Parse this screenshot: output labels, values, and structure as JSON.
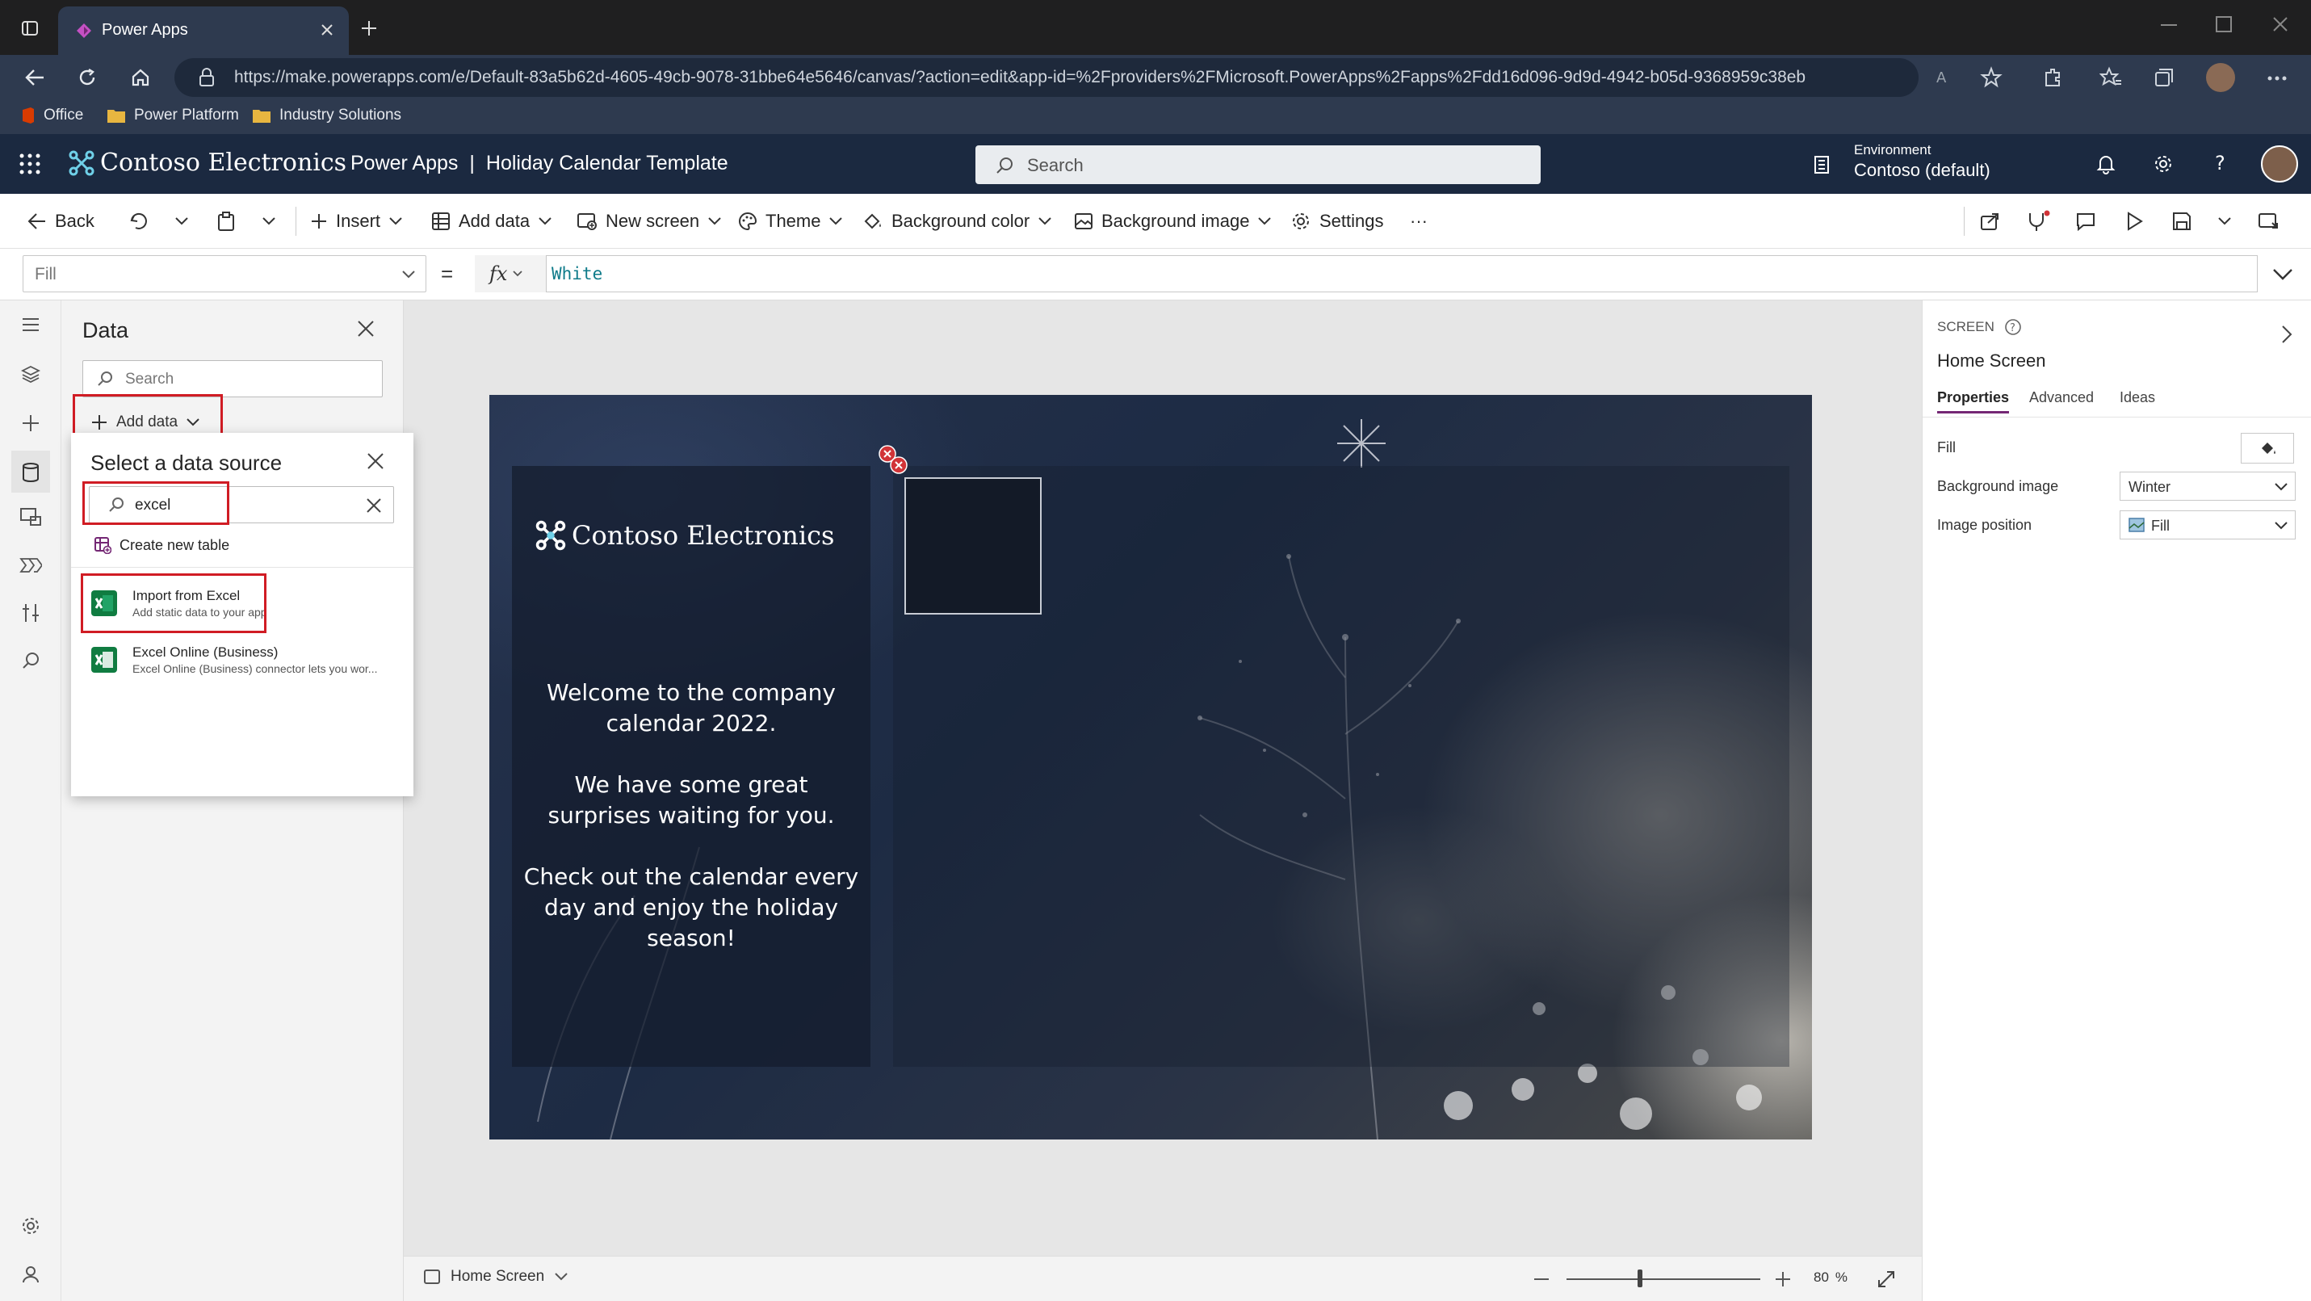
{
  "browser": {
    "tab_title": "Power Apps",
    "url": "https://make.powerapps.com/e/Default-83a5b62d-4605-49cb-9078-31bbe64e5646/canvas/?action=edit&app-id=%2Fproviders%2FMicrosoft.PowerApps%2Fapps%2Fdd16d096-9d9d-4942-b05d-9368959c38eb",
    "favorites": [
      "Office",
      "Power Platform",
      "Industry Solutions"
    ]
  },
  "header": {
    "brand": "Contoso Electronics",
    "app_name": "Power Apps",
    "separator": "|",
    "app_title": "Holiday Calendar Template",
    "search_placeholder": "Search",
    "environment_label": "Environment",
    "environment_value": "Contoso (default)"
  },
  "commandbar": {
    "back": "Back",
    "insert": "Insert",
    "add_data": "Add data",
    "new_screen": "New screen",
    "theme": "Theme",
    "background_color": "Background color",
    "background_image": "Background image",
    "settings": "Settings",
    "more": "···"
  },
  "formula": {
    "property": "Fill",
    "equals": "=",
    "fx": "fx",
    "value": "White"
  },
  "data_pane": {
    "title": "Data",
    "search_placeholder": "Search",
    "add_data": "Add data"
  },
  "popup": {
    "title": "Select a data source",
    "search_value": "excel",
    "create_new_table": "Create new table",
    "items": [
      {
        "title": "Import from Excel",
        "subtitle": "Add static data to your app"
      },
      {
        "title": "Excel Online (Business)",
        "subtitle": "Excel Online (Business) connector lets you wor..."
      }
    ]
  },
  "canvas": {
    "brand": "Contoso Electronics",
    "welcome_1a": "Welcome to the company",
    "welcome_1b": "calendar 2022.",
    "welcome_2a": "We have some great",
    "welcome_2b": "surprises waiting for you.",
    "welcome_3a": "Check out the calendar every",
    "welcome_3b": "day and enjoy the holiday",
    "welcome_3c": "season!"
  },
  "bottombar": {
    "screen_name": "Home Screen",
    "zoom_value": "80",
    "zoom_unit": "%",
    "zoom_level": 0.8
  },
  "properties": {
    "kind": "SCREEN",
    "name": "Home Screen",
    "tabs": [
      "Properties",
      "Advanced",
      "Ideas"
    ],
    "fill_label": "Fill",
    "bg_image_label": "Background image",
    "bg_image_value": "Winter",
    "image_position_label": "Image position",
    "image_position_value": "Fill"
  },
  "colors": {
    "accent": "#742774",
    "header_bg": "#1b2940",
    "highlight_red": "#d01c24",
    "excel_green": "#107c41"
  }
}
